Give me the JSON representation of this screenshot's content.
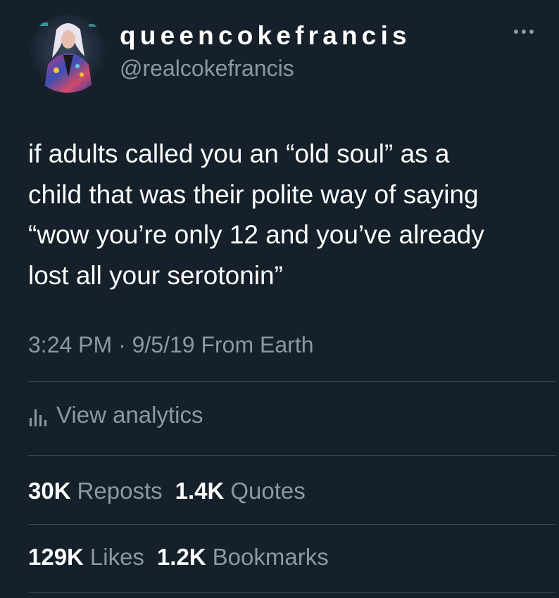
{
  "user": {
    "display_name": "queencokefrancis",
    "handle": "@realcokefrancis",
    "avatar_icon": "profile-photo",
    "more_icon": "more-options-icon"
  },
  "tweet": {
    "text": "if adults called you an “old soul” as a\nchild that was their polite way of saying\n“wow you’re only 12 and you’ve already\nlost all your serotonin”",
    "meta": "3:24 PM · 9/5/19 From Earth"
  },
  "analytics": {
    "icon": "bar-chart-icon",
    "label": "View analytics"
  },
  "stats": {
    "reposts": {
      "count": "30K",
      "label": "Reposts"
    },
    "quotes": {
      "count": "1.4K",
      "label": "Quotes"
    },
    "likes": {
      "count": "129K",
      "label": "Likes"
    },
    "bookmarks": {
      "count": "1.2K",
      "label": "Bookmarks"
    }
  },
  "colors": {
    "background": "#15202b",
    "primary_text": "#ffffff",
    "secondary_text": "#8b98a5",
    "divider": "#38444d"
  }
}
